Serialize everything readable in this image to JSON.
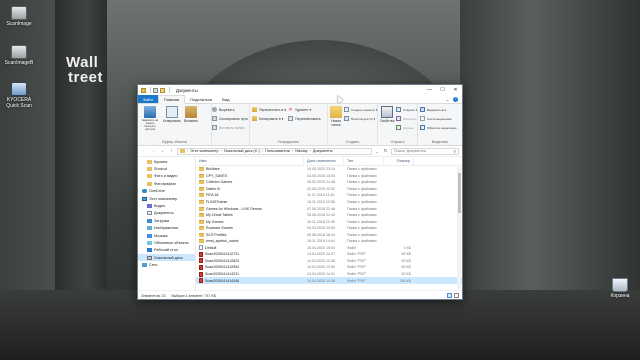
{
  "desktop": {
    "wallpaper_sign": [
      "Wall",
      "treet"
    ],
    "icons": [
      {
        "name": "scan-icon-1",
        "label": "ScanImage"
      },
      {
        "name": "scan-icon-2",
        "label": "ScanImageB"
      },
      {
        "name": "kyocera-quickscan",
        "label": "KYOCERA Quick Scan"
      },
      {
        "name": "recycle-bin",
        "label": "Корзина"
      }
    ]
  },
  "window": {
    "title": "Документы",
    "controls": {
      "minimize": "—",
      "maximize": "☐",
      "close": "✕"
    }
  },
  "ribbon_tabs": [
    {
      "label": "Файл",
      "state": "file"
    },
    {
      "label": "Главная",
      "state": "active"
    },
    {
      "label": "Поделиться",
      "state": ""
    },
    {
      "label": "Вид",
      "state": ""
    }
  ],
  "ribbon": {
    "clipboard": {
      "group_label": "Буфер обмена",
      "pin": "Закрепить на панели быстрого доступа",
      "copy": "Копировать",
      "paste": "Вставить",
      "cut": "Вырезать",
      "copy_path": "Скопировать путь",
      "paste_shortcut": "Вставить ярлык"
    },
    "organize": {
      "group_label": "Упорядочить",
      "move_to": "Переместить в ▾",
      "copy_to": "Копировать в ▾",
      "delete": "Удалить ▾",
      "rename": "Переименовать"
    },
    "new": {
      "group_label": "Создать",
      "new_folder": "Новая папка",
      "new_item": "Создать элемент ▾",
      "easy_access": "Простой доступ ▾"
    },
    "open": {
      "group_label": "Открыть",
      "properties": "Свойства",
      "open": "Открыть ▾",
      "edit": "Изменить",
      "history": "Журнал"
    },
    "select": {
      "group_label": "Выделить",
      "select_all": "Выделить все",
      "select_none": "Снять выделение",
      "invert": "Обратить выделение"
    }
  },
  "address": {
    "path": [
      "Этот компьютер",
      "Локальный диск (C:)",
      "Пользователи",
      "Nikolay",
      "Документы"
    ],
    "search_placeholder": "Поиск: Документы"
  },
  "navpane": [
    {
      "label": "Кукояга",
      "icon": "n-folder",
      "level": "l2",
      "selected": false
    },
    {
      "label": "Shotcut",
      "icon": "n-folder",
      "level": "l2",
      "selected": false
    },
    {
      "label": "Фото и видео",
      "icon": "n-folder",
      "level": "l2",
      "selected": false
    },
    {
      "label": "Фотографии",
      "icon": "n-folder",
      "level": "l2",
      "selected": false
    },
    {
      "label": "OneDrive",
      "icon": "n-cloud",
      "level": "l1",
      "selected": false
    },
    {
      "label": "Этот компьютер",
      "icon": "n-pc",
      "level": "l1",
      "selected": false
    },
    {
      "label": "Видео",
      "icon": "n-video",
      "level": "l2",
      "selected": false
    },
    {
      "label": "Документы",
      "icon": "n-doc",
      "level": "l2",
      "selected": false
    },
    {
      "label": "Загрузки",
      "icon": "n-down",
      "level": "l2",
      "selected": false
    },
    {
      "label": "Изображения",
      "icon": "n-img",
      "level": "l2",
      "selected": false
    },
    {
      "label": "Музыка",
      "icon": "n-music",
      "level": "l2",
      "selected": false
    },
    {
      "label": "Объемные объекты",
      "icon": "n-3d",
      "level": "l2",
      "selected": false
    },
    {
      "label": "Рабочий стол",
      "icon": "n-desk",
      "level": "l2",
      "selected": false
    },
    {
      "label": "Локальный диск",
      "icon": "n-disk",
      "level": "l2",
      "selected": true
    },
    {
      "label": "Сеть",
      "icon": "n-net",
      "level": "l1",
      "selected": false
    }
  ],
  "columns": {
    "name": "Имя",
    "date": "Дата изменения",
    "type": "Тип",
    "size": "Размер"
  },
  "files": [
    {
      "name": "BioWare",
      "date": "19.05.2020 23:24",
      "type": "Папка с файлами",
      "size": "",
      "icon": "f-folder",
      "selected": false
    },
    {
      "name": "CPY_SAVES",
      "date": "04.06.2018 13:53",
      "type": "Папка с файлами",
      "size": "",
      "icon": "f-folder",
      "selected": false
    },
    {
      "name": "Criterion Games",
      "date": "26.02.2019 21:48",
      "type": "Папка с файлами",
      "size": "",
      "icon": "f-folder",
      "selected": false
    },
    {
      "name": "Diablo III",
      "date": "22.06.2019 22:02",
      "type": "Папка с файлами",
      "size": "",
      "icon": "f-folder",
      "selected": false
    },
    {
      "name": "FIFA 18",
      "date": "11.07.2018 11:40",
      "type": "Папка с файлами",
      "size": "",
      "icon": "f-folder",
      "selected": false
    },
    {
      "name": "FLiNGTrainer",
      "date": "18.11.2019 22:58",
      "type": "Папка с файлами",
      "size": "",
      "icon": "f-folder",
      "selected": false
    },
    {
      "name": "Games for Windows - LIVE Demos",
      "date": "07.06.2018 22:46",
      "type": "Папка с файлами",
      "size": "",
      "icon": "f-folder",
      "selected": false
    },
    {
      "name": "My Cheat Tables",
      "date": "25.06.2018 21:42",
      "type": "Папка с файлами",
      "size": "",
      "icon": "f-folder",
      "selected": false
    },
    {
      "name": "My Games",
      "date": "16.11.2018 22:45",
      "type": "Папка с файлами",
      "size": "",
      "icon": "f-folder",
      "selected": false
    },
    {
      "name": "Rockstar Games",
      "date": "04.03.2019 20:59",
      "type": "Папка с файлами",
      "size": "",
      "icon": "f-folder",
      "selected": false
    },
    {
      "name": "SCS Profiles",
      "date": "05.08.2018 18:44",
      "type": "Папка с файлами",
      "size": "",
      "icon": "f-folder",
      "selected": false
    },
    {
      "name": "wmd_symbol_cache",
      "date": "18.11.2019 14:44",
      "type": "Папка с файлами",
      "size": "",
      "icon": "f-folder",
      "selected": false
    },
    {
      "name": "Default",
      "date": "15.04.2020 19:04",
      "type": "Файл",
      "size": "1 КБ",
      "icon": "f-file",
      "selected": false
    },
    {
      "name": "Scan2020041412731",
      "date": "14.04.2020 12:27",
      "type": "Файл \"PDF\"",
      "size": "62 КБ",
      "icon": "f-pdf",
      "selected": false
    },
    {
      "name": "Scan2020041412823",
      "date": "14.04.2020 12:38",
      "type": "Файл \"PDF\"",
      "size": "63 КБ",
      "icon": "f-pdf",
      "selected": false
    },
    {
      "name": "Scan2020041412954",
      "date": "14.04.2020 12:54",
      "type": "Файл \"PDF\"",
      "size": "62 КБ",
      "icon": "f-pdf",
      "selected": false
    },
    {
      "name": "Scan2020041414231",
      "date": "14.04.2020 14:31",
      "type": "Файл \"PDF\"",
      "size": "62 КБ",
      "icon": "f-pdf",
      "selected": false
    },
    {
      "name": "Scan2020041414346",
      "date": "14.04.2020 14:36",
      "type": "Файл \"PDF\"",
      "size": "746 КБ",
      "icon": "f-pdf",
      "selected": true
    }
  ],
  "status": {
    "count": "Элементов: 23",
    "selection": "Выбран 1 элемент: 747 КБ"
  }
}
